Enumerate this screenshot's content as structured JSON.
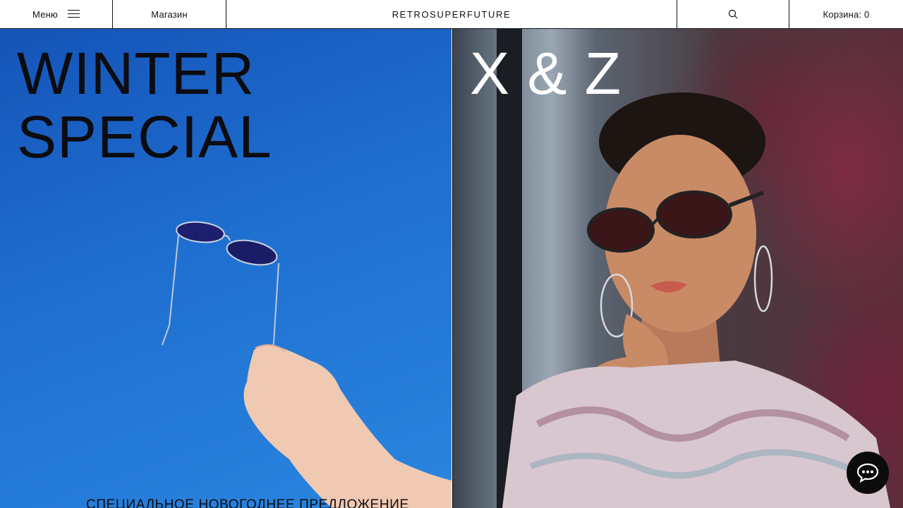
{
  "header": {
    "menu_label": "Меню",
    "shop_label": "Магазин",
    "brand": "RETROSUPERFUTURE",
    "cart_label": "Корзина: 0"
  },
  "promos": [
    {
      "title": "WINTER\nSPECIAL",
      "subtitle": "СПЕЦИАЛЬНОЕ НОВОГОДНЕЕ ПРЕДЛОЖЕНИЕ",
      "background_color": "#1f6fd0"
    },
    {
      "title": "X & Z",
      "background_color": "#5b2e3a"
    }
  ],
  "icons": {
    "menu": "hamburger-icon",
    "search": "search-icon",
    "chat": "chat-bubble-icon"
  },
  "colors": {
    "border": "#111111",
    "title_dark": "#0c0c10",
    "title_light": "#ffffff"
  }
}
